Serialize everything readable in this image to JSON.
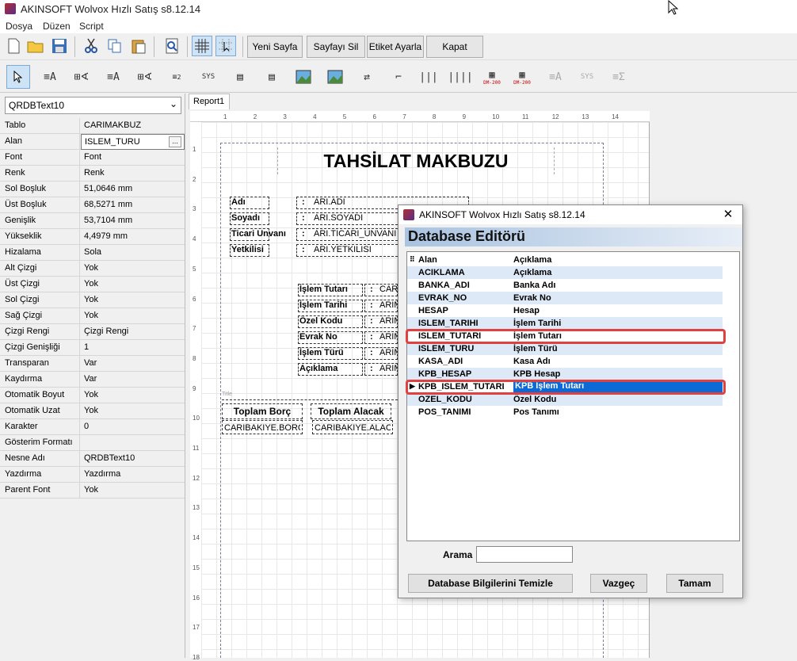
{
  "window": {
    "title": "AKINSOFT Wolvox Hızlı Satış s8.12.14"
  },
  "menu": [
    "Dosya",
    "Düzen",
    "Script"
  ],
  "toolbar": {
    "new_page": "Yeni Sayfa",
    "delete_page": "Sayfayı Sil",
    "label_settings": "Etiket Ayarla",
    "close": "Kapat"
  },
  "toolbar2": {
    "sys1": "SYS",
    "dm1": "DM-200",
    "dm2": "DM-200",
    "sys2": "SYS"
  },
  "left_panel": {
    "selected_object": "QRDBText10",
    "properties": [
      {
        "name": "Tablo",
        "value": "CARIMAKBUZ"
      },
      {
        "name": "Alan",
        "value": "ISLEM_TURU"
      },
      {
        "name": "Font",
        "value": "Font"
      },
      {
        "name": "Renk",
        "value": "Renk"
      },
      {
        "name": "Sol Boşluk",
        "value": "51,0646 mm"
      },
      {
        "name": "Üst Boşluk",
        "value": "68,5271 mm"
      },
      {
        "name": "Genişlik",
        "value": "53,7104 mm"
      },
      {
        "name": "Yükseklik",
        "value": "4,4979 mm"
      },
      {
        "name": "Hizalama",
        "value": "Sola"
      },
      {
        "name": "Alt Çizgi",
        "value": "Yok"
      },
      {
        "name": "Üst Çizgi",
        "value": "Yok"
      },
      {
        "name": "Sol Çizgi",
        "value": "Yok"
      },
      {
        "name": "Sağ Çizgi",
        "value": "Yok"
      },
      {
        "name": "Çizgi Rengi",
        "value": "Çizgi Rengi"
      },
      {
        "name": "Çizgi Genişliği",
        "value": "1"
      },
      {
        "name": "Transparan",
        "value": "Var"
      },
      {
        "name": "Kaydırma",
        "value": "Var"
      },
      {
        "name": "Otomatik Boyut",
        "value": "Yok"
      },
      {
        "name": "Otomatik Uzat",
        "value": "Yok"
      },
      {
        "name": "Karakter",
        "value": "0"
      },
      {
        "name": "Gösterim Formatı",
        "value": ""
      },
      {
        "name": "Nesne Adı",
        "value": "QRDBText10"
      },
      {
        "name": "Yazdırma",
        "value": "Yazdırma"
      },
      {
        "name": "Parent Font",
        "value": "Yok"
      }
    ]
  },
  "report": {
    "tab": "Report1",
    "ruler_h": [
      "1",
      "2",
      "3",
      "4",
      "5",
      "6",
      "7",
      "8",
      "9",
      "10",
      "11",
      "12",
      "13",
      "14"
    ],
    "ruler_v": [
      "1",
      "2",
      "3",
      "4",
      "5",
      "6",
      "7",
      "8",
      "9",
      "10",
      "11",
      "12",
      "13",
      "14",
      "15",
      "16",
      "17",
      "18"
    ],
    "title": "TAHSİLAT MAKBUZU",
    "band_label": "Title",
    "labels1": [
      "Adı",
      "Soyadı",
      "Ticari Unvanı",
      "Yetkilisi"
    ],
    "colon": ":",
    "fields1": [
      "ARI.ADI",
      "ARI.SOYADI",
      "ARI.TICARI_UNVANI",
      "ARI.YETKILISI"
    ],
    "labels2": [
      "İşlem Tutarı",
      "İşlem Tarihi",
      "Özel Kodu",
      "Evrak No",
      "İşlem Türü",
      "Açıklama"
    ],
    "fields2": [
      "CAR",
      "ARIM",
      "ARIM",
      "ARIM",
      "ARIM",
      "ARIM"
    ],
    "totals_labels": [
      "Toplam Borç",
      "Toplam Alacak"
    ],
    "totals_fields": [
      "CARIBAKIYE.BORC",
      "CARIBAKIYE.ALAC"
    ]
  },
  "dialog": {
    "title": "AKINSOFT Wolvox Hızlı Satış s8.12.14",
    "header": "Database Editörü",
    "columns": [
      "Alan",
      "Açıklama"
    ],
    "rows": [
      {
        "field": "ACIKLAMA",
        "desc": "Açıklama"
      },
      {
        "field": "BANKA_ADI",
        "desc": "Banka Adı"
      },
      {
        "field": "EVRAK_NO",
        "desc": "Evrak No"
      },
      {
        "field": "HESAP",
        "desc": "Hesap"
      },
      {
        "field": "ISLEM_TARIHI",
        "desc": "İşlem Tarihi"
      },
      {
        "field": "ISLEM_TUTARI",
        "desc": "İşlem Tutarı"
      },
      {
        "field": "ISLEM_TURU",
        "desc": "İşlem Türü"
      },
      {
        "field": "KASA_ADI",
        "desc": "Kasa Adı"
      },
      {
        "field": "KPB_HESAP",
        "desc": "KPB Hesap"
      },
      {
        "field": "KPB_ISLEM_TUTARI",
        "desc": "KPB İşlem Tutarı"
      },
      {
        "field": "OZEL_KODU",
        "desc": "Özel Kodu"
      },
      {
        "field": "POS_TANIMI",
        "desc": "Pos Tanımı"
      }
    ],
    "search_label": "Arama",
    "search_value": "",
    "btn_clear": "Database Bilgilerini Temizle",
    "btn_cancel": "Vazgeç",
    "btn_ok": "Tamam",
    "close_glyph": "✕",
    "row_marker": "▶",
    "header_marker": "⠿"
  },
  "colors": {
    "accent": "#0b6ad6",
    "highlight": "#e04040",
    "alt_row": "#dde9f7"
  }
}
